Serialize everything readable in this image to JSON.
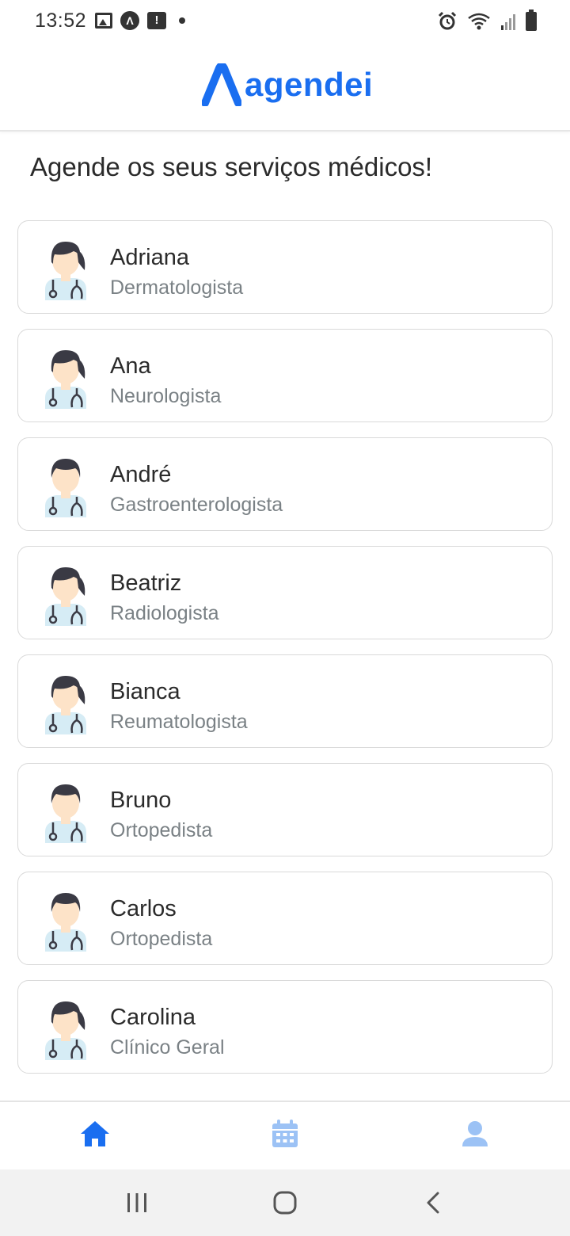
{
  "status_bar": {
    "time": "13:52"
  },
  "header": {
    "logo_text": "agendei",
    "brand_color": "#1a6ef0"
  },
  "main": {
    "title": "Agende os seus serviços médicos!",
    "doctors": [
      {
        "name": "Adriana",
        "specialty": "Dermatologista",
        "avatar": "female-doctor-icon"
      },
      {
        "name": "Ana",
        "specialty": "Neurologista",
        "avatar": "female-doctor-icon"
      },
      {
        "name": "André",
        "specialty": "Gastroenterologista",
        "avatar": "male-doctor-icon"
      },
      {
        "name": "Beatriz",
        "specialty": "Radiologista",
        "avatar": "female-doctor-icon"
      },
      {
        "name": "Bianca",
        "specialty": "Reumatologista",
        "avatar": "female-doctor-icon"
      },
      {
        "name": "Bruno",
        "specialty": "Ortopedista",
        "avatar": "male-doctor-icon"
      },
      {
        "name": "Carlos",
        "specialty": "Ortopedista",
        "avatar": "male-doctor-icon"
      },
      {
        "name": "Carolina",
        "specialty": "Clínico Geral",
        "avatar": "female-doctor-icon"
      }
    ]
  },
  "bottom_nav": {
    "items": [
      {
        "icon": "home-icon",
        "active": true,
        "color": "#1a6ef0"
      },
      {
        "icon": "calendar-icon",
        "active": false,
        "color": "#9cc2f5"
      },
      {
        "icon": "profile-icon",
        "active": false,
        "color": "#9cc2f5"
      }
    ]
  }
}
